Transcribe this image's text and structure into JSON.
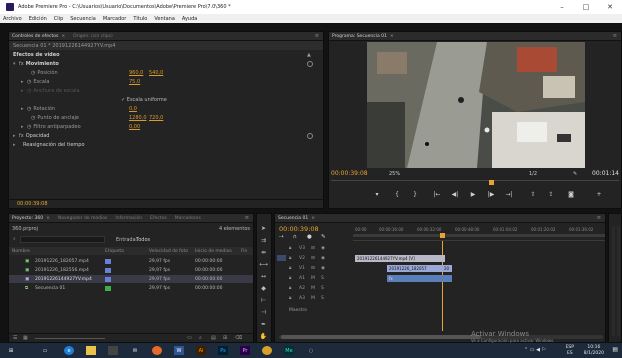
{
  "window": {
    "title": "Adobe Premiere Pro - C:\\Usuarios\\Usuario\\Documentos\\Adobe\\Premiere Pro\\7.0\\360 *",
    "controls": [
      "–",
      "□",
      "✕"
    ]
  },
  "menu": [
    "Archivo",
    "Edición",
    "Clip",
    "Secuencia",
    "Marcador",
    "Título",
    "Ventana",
    "Ayuda"
  ],
  "effect_controls": {
    "tabs": [
      "Controles de efectos",
      "Origen: (sin clips)"
    ],
    "sequence_label": "Secuencia 01 * 20191226144927YV.mp4",
    "section": "Efectos de vídeo",
    "properties": [
      {
        "name": "Movimiento",
        "values": []
      },
      {
        "name": "Posición",
        "values": [
          "960,0",
          "540,0"
        ]
      },
      {
        "name": "Escala",
        "values": [
          "75,0"
        ]
      },
      {
        "name": "Anchura de escala",
        "values": []
      },
      {
        "name": "",
        "values": []
      },
      {
        "name": "Rotación",
        "values": [
          "0,0"
        ]
      },
      {
        "name": "Punto de anclaje",
        "values": [
          "1280,0",
          "720,0"
        ]
      },
      {
        "name": "Filtro antiparpadeo",
        "values": [
          "0,00"
        ]
      },
      {
        "name": "Opacidad",
        "values": []
      },
      {
        "name": "Reasignación del tiempo",
        "values": []
      }
    ],
    "uniform_scale": "Escala uniforme",
    "timecode": "00:00:39:08"
  },
  "program": {
    "tab": "Programa: Secuencia 01",
    "timecode": "00:00:39:08",
    "zoom": "25%",
    "quality": "1/2",
    "duration": "00:01:14"
  },
  "project": {
    "tabs": [
      "Proyecto: 360",
      "Navegador de medios",
      "Información",
      "Efectos",
      "Marcadores"
    ],
    "file": "360.prproj",
    "count": "4 elementos",
    "search_placeholder": "",
    "entry_label": "Entrada:",
    "entry_value": "Todos",
    "columns": [
      "Nombre",
      "Etiqueta",
      "Velocidad de foto",
      "Inicio de medios",
      "Fin"
    ],
    "rows": [
      {
        "name": "20191226_182057.mp4",
        "fps": "29,97 fps",
        "start": "00:00:00:00",
        "color": "#6a7fd8"
      },
      {
        "name": "20191226_182556.mp4",
        "fps": "29,97 fps",
        "start": "00:00:00:00",
        "color": "#6a7fd8"
      },
      {
        "name": "20191226144927YV.mp4",
        "fps": "29,97 fps",
        "start": "00:00:00:00",
        "color": "#6a7fd8"
      },
      {
        "name": "Secuencia 01",
        "fps": "29,97 fps",
        "start": "00:00:00:00",
        "color": "#3fae49"
      }
    ]
  },
  "timeline": {
    "tab": "Secuencia 01",
    "timecode": "00:00:39:08",
    "ruler": [
      "00:00",
      "00:00:16:00",
      "00:00:32:00",
      "00:00:48:00",
      "00:01:04:02",
      "00:01:20:02",
      "00:01:36:02"
    ],
    "tracks": [
      "V3",
      "V2",
      "V1",
      "A1",
      "A2",
      "A3",
      "Maestro"
    ],
    "clips": {
      "v2": "20191226144927YV.mp4 [V]",
      "v1": "20191226_182057",
      "v1b": "20",
      "a1": "fx"
    }
  },
  "watermark": {
    "line1": "Activar Windows",
    "line2": "Ve a Configuración para activar Windows."
  },
  "taskbar": {
    "lang": "ESP",
    "lang2": "ES",
    "time": "10:16",
    "date": "8/1/2020"
  }
}
